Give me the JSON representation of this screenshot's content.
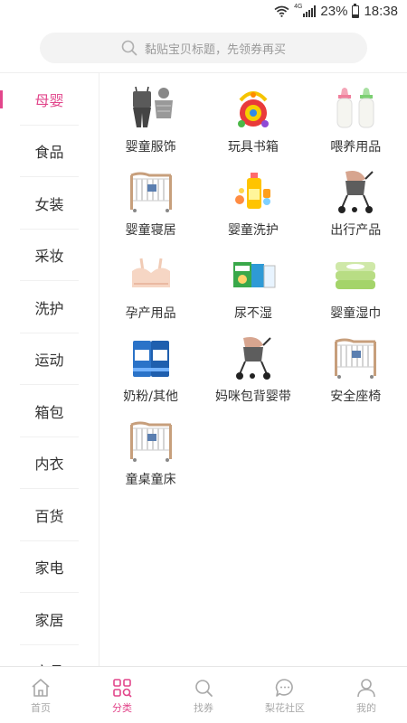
{
  "status_bar": {
    "battery": "23%",
    "time": "18:38",
    "network": "4G"
  },
  "search": {
    "placeholder": "黏贴宝贝标题，先领券再买"
  },
  "sidebar": {
    "items": [
      {
        "label": "母婴",
        "active": true
      },
      {
        "label": "食品"
      },
      {
        "label": "女装"
      },
      {
        "label": "采妆"
      },
      {
        "label": "洗护"
      },
      {
        "label": "运动"
      },
      {
        "label": "箱包"
      },
      {
        "label": "内衣"
      },
      {
        "label": "百货"
      },
      {
        "label": "家电"
      },
      {
        "label": "家居"
      },
      {
        "label": "文具"
      }
    ]
  },
  "categories": [
    {
      "label": "婴童服饰",
      "icon": "baby-clothes-icon"
    },
    {
      "label": "玩具书箱",
      "icon": "toy-icon"
    },
    {
      "label": "喂养用品",
      "icon": "feeding-bottle-icon"
    },
    {
      "label": "婴童寝居",
      "icon": "crib-icon"
    },
    {
      "label": "婴童洗护",
      "icon": "baby-care-icon"
    },
    {
      "label": "出行产品",
      "icon": "stroller-icon"
    },
    {
      "label": "孕产用品",
      "icon": "maternity-bra-icon"
    },
    {
      "label": "尿不湿",
      "icon": "diaper-icon"
    },
    {
      "label": "婴童湿巾",
      "icon": "wet-wipes-icon"
    },
    {
      "label": "奶粉/其他",
      "icon": "milk-powder-icon"
    },
    {
      "label": "妈咪包背婴带",
      "icon": "stroller-icon"
    },
    {
      "label": "安全座椅",
      "icon": "crib-icon"
    },
    {
      "label": "童桌童床",
      "icon": "crib-icon"
    }
  ],
  "tabbar": {
    "tabs": [
      {
        "label": "首页",
        "icon": "home-icon"
      },
      {
        "label": "分类",
        "icon": "category-icon",
        "active": true
      },
      {
        "label": "找券",
        "icon": "search-icon"
      },
      {
        "label": "梨花社区",
        "icon": "chat-icon"
      },
      {
        "label": "我的",
        "icon": "user-icon"
      }
    ]
  },
  "colors": {
    "accent": "#e2468b",
    "text": "#333333",
    "muted": "#a8a8a8"
  }
}
